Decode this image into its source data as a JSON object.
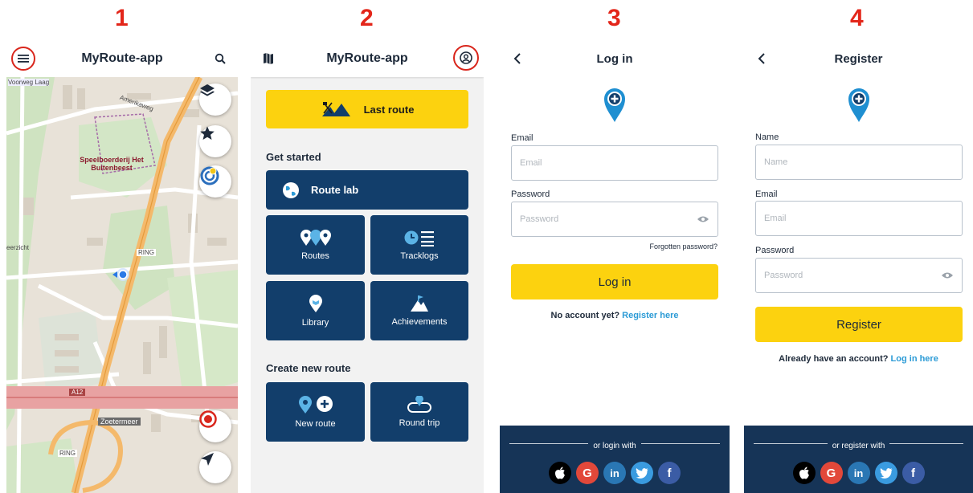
{
  "steps": [
    "1",
    "2",
    "3",
    "4"
  ],
  "screen1": {
    "title": "MyRoute-app",
    "map_labels": {
      "street_top": "Voorweg Laag",
      "street_amer": "Amerikaweg",
      "poi": "Speelboerderij Het Buitenbeest",
      "edge": "eerzicht",
      "ring_mid": "RING",
      "ring_bottom": "RING",
      "a12": "A12",
      "city": "Zoetermeer"
    }
  },
  "screen2": {
    "title": "MyRoute-app",
    "last_route": "Last route",
    "get_started": "Get started",
    "route_lab": "Route lab",
    "routes": "Routes",
    "tracklogs": "Tracklogs",
    "library": "Library",
    "achievements": "Achievements",
    "create_new_route": "Create new route",
    "new_route": "New route",
    "round_trip": "Round trip"
  },
  "screen3": {
    "title": "Log in",
    "email_label": "Email",
    "email_placeholder": "Email",
    "password_label": "Password",
    "password_placeholder": "Password",
    "forgot": "Forgotten password?",
    "login_button": "Log in",
    "no_account": "No account yet?",
    "register_link": "Register here",
    "or_text": "or login with"
  },
  "screen4": {
    "title": "Register",
    "name_label": "Name",
    "name_placeholder": "Name",
    "email_label": "Email",
    "email_placeholder": "Email",
    "password_label": "Password",
    "password_placeholder": "Password",
    "register_button": "Register",
    "have_account": "Already have an account?",
    "login_link": "Log in here",
    "or_text": "or register with"
  },
  "social_glyphs": {
    "google": "G",
    "linkedin": "in",
    "facebook": "f"
  },
  "colors": {
    "navy": "#123e6b",
    "yellow": "#fcd20f",
    "red": "#e3261a",
    "link": "#2c9bd6",
    "footer": "#163457"
  }
}
